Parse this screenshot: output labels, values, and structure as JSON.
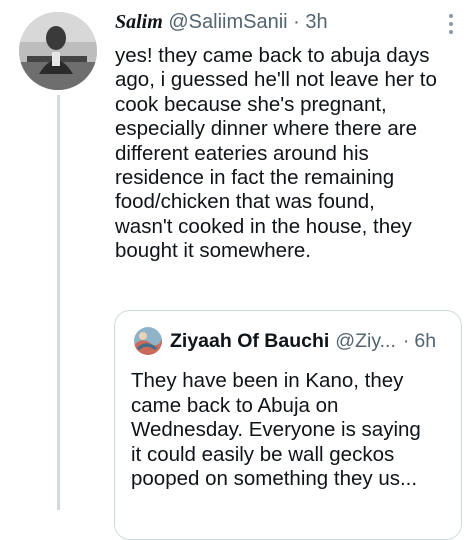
{
  "tweet": {
    "author_name": "Salim",
    "author_handle": "@SaliimSanii",
    "separator": "·",
    "time": "3h",
    "text_lines": [
      "yes! they came back to abuja days",
      "ago, i guessed he'll not leave her to",
      "cook because she's pregnant,",
      "especially dinner where there are",
      "different eateries around his",
      "residence in fact the remaining",
      "food/chicken that was found,",
      "wasn't cooked in the house, they",
      "bought it somewhere."
    ]
  },
  "quoted_tweet": {
    "author_name": "Ziyaah Of Bauchi",
    "author_handle": "@Ziy...",
    "separator": "·",
    "time": "6h",
    "text_lines": [
      "They have been in Kano, they",
      "came back to Abuja on",
      "Wednesday. Everyone is saying",
      "it could easily be wall geckos",
      "pooped on something they us..."
    ]
  },
  "icons": {
    "more": "more-vertical-icon",
    "avatar": "avatar",
    "quote_avatar": "quote-avatar"
  },
  "colors": {
    "text_primary": "#0f1419",
    "text_secondary": "#536471",
    "border": "#cfd9de",
    "thread_line": "#cfd9de"
  }
}
